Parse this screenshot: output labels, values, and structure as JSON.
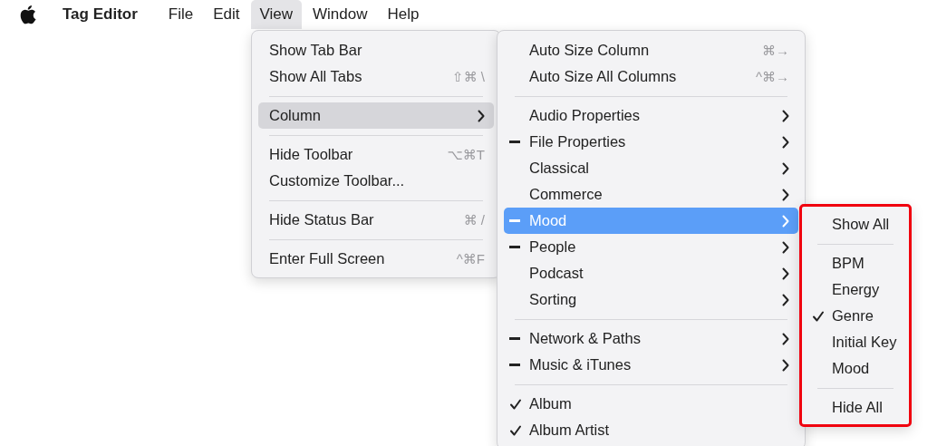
{
  "menu_bar": {
    "app_name": "Tag Editor",
    "items": [
      {
        "label": "File",
        "selected": false
      },
      {
        "label": "Edit",
        "selected": false
      },
      {
        "label": "View",
        "selected": true
      },
      {
        "label": "Window",
        "selected": false
      },
      {
        "label": "Help",
        "selected": false
      }
    ]
  },
  "menus": [
    {
      "highlighted": false,
      "items": [
        {
          "kind": "item",
          "label": "Show Tab Bar",
          "selected": false
        },
        {
          "kind": "item",
          "label": "Show All Tabs",
          "shortcut": "⇧⌘ \\",
          "selected": false
        },
        {
          "kind": "separator"
        },
        {
          "kind": "item",
          "label": "Column",
          "selected": true,
          "submenu": true
        },
        {
          "kind": "separator"
        },
        {
          "kind": "item",
          "label": "Hide Toolbar",
          "shortcut": "⌥⌘T",
          "selected": false
        },
        {
          "kind": "item",
          "label": "Customize Toolbar...",
          "selected": false
        },
        {
          "kind": "separator"
        },
        {
          "kind": "item",
          "label": "Hide Status Bar",
          "shortcut": "⌘ /",
          "selected": false
        },
        {
          "kind": "separator"
        },
        {
          "kind": "item",
          "label": "Enter Full Screen",
          "shortcut": "^⌘F",
          "selected": false
        }
      ]
    },
    {
      "highlighted": false,
      "items": [
        {
          "kind": "item",
          "label": "Auto Size Column",
          "shortcut": "⌘→",
          "selected": false
        },
        {
          "kind": "item",
          "label": "Auto Size All Columns",
          "shortcut": "^⌘→",
          "selected": false
        },
        {
          "kind": "separator"
        },
        {
          "kind": "item",
          "label": "Audio Properties",
          "checked": false,
          "mixed": false,
          "selected": false,
          "submenu": true
        },
        {
          "kind": "item",
          "label": "File Properties",
          "checked": false,
          "mixed": true,
          "selected": false,
          "submenu": true
        },
        {
          "kind": "item",
          "label": "Classical",
          "checked": false,
          "mixed": false,
          "selected": false,
          "submenu": true
        },
        {
          "kind": "item",
          "label": "Commerce",
          "checked": false,
          "mixed": false,
          "selected": false,
          "submenu": true
        },
        {
          "kind": "item",
          "label": "Mood",
          "checked": false,
          "mixed": true,
          "selected": true,
          "submenu": true
        },
        {
          "kind": "item",
          "label": "People",
          "checked": false,
          "mixed": true,
          "selected": false,
          "submenu": true
        },
        {
          "kind": "item",
          "label": "Podcast",
          "checked": false,
          "mixed": false,
          "selected": false,
          "submenu": true
        },
        {
          "kind": "item",
          "label": "Sorting",
          "checked": false,
          "mixed": false,
          "selected": false,
          "submenu": true
        },
        {
          "kind": "separator"
        },
        {
          "kind": "item",
          "label": "Network & Paths",
          "checked": false,
          "mixed": true,
          "selected": false,
          "submenu": true
        },
        {
          "kind": "item",
          "label": "Music & iTunes",
          "checked": false,
          "mixed": true,
          "selected": false,
          "submenu": true
        },
        {
          "kind": "separator"
        },
        {
          "kind": "item",
          "label": "Album",
          "checked": true,
          "mixed": false,
          "selected": false
        },
        {
          "kind": "item",
          "label": "Album Artist",
          "checked": true,
          "mixed": false,
          "selected": false
        }
      ]
    },
    {
      "highlighted": true,
      "items": [
        {
          "kind": "item",
          "label": "Show All",
          "selected": false
        },
        {
          "kind": "separator"
        },
        {
          "kind": "item",
          "label": "BPM",
          "checked": false,
          "selected": false
        },
        {
          "kind": "item",
          "label": "Energy",
          "checked": false,
          "selected": false
        },
        {
          "kind": "item",
          "label": "Genre",
          "checked": true,
          "selected": false
        },
        {
          "kind": "item",
          "label": "Initial Key",
          "checked": false,
          "selected": false
        },
        {
          "kind": "item",
          "label": "Mood",
          "checked": false,
          "selected": false
        },
        {
          "kind": "separator"
        },
        {
          "kind": "item",
          "label": "Hide All",
          "selected": false
        }
      ]
    }
  ]
}
